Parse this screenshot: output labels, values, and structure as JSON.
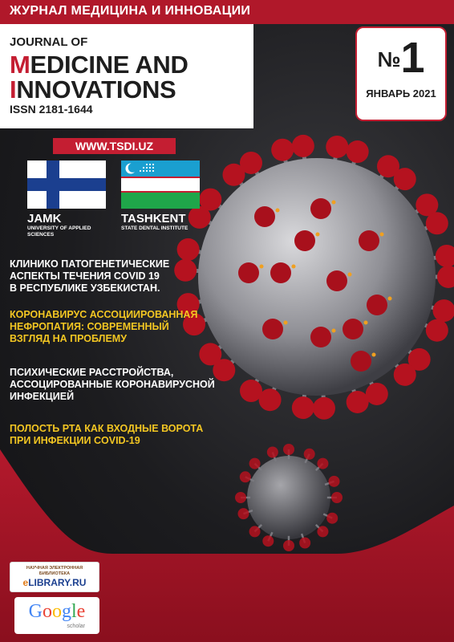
{
  "top_banner": {
    "text": "ЖУРНАЛ МЕДИЦИНА И ИННОВАЦИИ"
  },
  "header": {
    "journal_of": "JOURNAL OF",
    "line1_cap": "M",
    "line1_rest": "EDICINE AND",
    "line2_cap": "I",
    "line2_rest": "NNOVATIONS",
    "issn": "ISSN 2181-1644"
  },
  "issue": {
    "symbol": "№",
    "number": "1",
    "date": "ЯНВАРЬ 2021"
  },
  "website": "WWW.TSDI.UZ",
  "partners": [
    {
      "name": "JAMK",
      "subtitle_line1": "UNIVERSITY OF APPLIED",
      "subtitle_line2": "SCIENCES"
    },
    {
      "name": "TASHKENT",
      "subtitle_line1": "STATE DENTAL INSTITUTE"
    }
  ],
  "headlines": [
    {
      "lines": [
        "КЛИНИКО ПАТОГЕНЕТИЧЕСКИЕ",
        "АСПЕКТЫ ТЕЧЕНИЯ COVID 19",
        "В РЕСПУБЛИКЕ УЗБЕКИСТАН."
      ],
      "color": "#ffffff"
    },
    {
      "lines": [
        "КОРОНАВИРУС АССОЦИИРОВАННАЯ",
        "НЕФРОПАТИЯ: СОВРЕМЕННЫЙ",
        "ВЗГЛЯД НА ПРОБЛЕМУ"
      ],
      "color": "#f3c622"
    },
    {
      "lines": [
        "ПСИХИЧЕСКИЕ РАССТРОЙСТВА,",
        "АССОЦИРОВАННЫЕ КОРОНАВИРУСНОЙ",
        "ИНФЕКЦИЕЙ"
      ],
      "color": "#ffffff"
    },
    {
      "lines": [
        "ПОЛОСТЬ РТА КАК ВХОДНЫЕ ВОРОТА",
        "ПРИ ИНФЕКЦИИ COVID-19"
      ],
      "color": "#f3c622"
    }
  ],
  "logos": {
    "elibrary": {
      "small_line1": "НАУЧНАЯ ЭЛЕКТРОННАЯ",
      "small_line2": "БИБЛИОТЕКА",
      "main_prefix": "e",
      "main_rest": "LIBRARY.RU"
    },
    "google": {
      "word": "Google",
      "sub": "scholar"
    }
  },
  "colors": {
    "brand_red": "#c41e32",
    "accent_yellow": "#f3c622",
    "finland_blue": "#1b3f8f",
    "uz_blue": "#1a9fd0",
    "uz_green": "#1fa64a"
  }
}
